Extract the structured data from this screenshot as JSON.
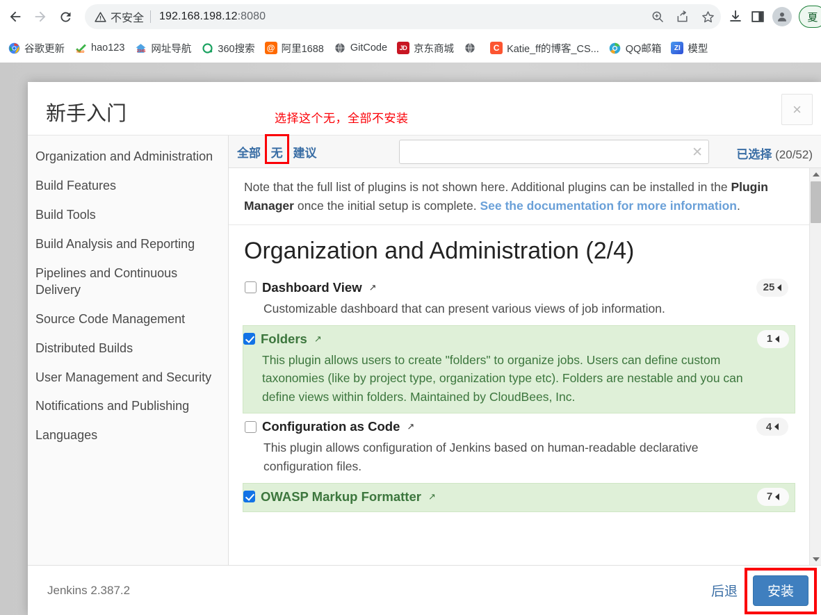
{
  "browser": {
    "nav": {
      "back_label": "Back",
      "forward_label": "Forward",
      "reload_label": "Reload"
    },
    "omnibox": {
      "warning_icon": "warning-triangle-icon",
      "warning_text": "不安全",
      "url_host": "192.168.198.12",
      "url_port": ":8080",
      "actions": [
        "zoom-icon",
        "share-icon",
        "bookmark-star-icon"
      ]
    },
    "toolbar_right": [
      "download-icon",
      "side-panel-icon",
      "account-avatar-icon"
    ],
    "profile_pill_text": "夏",
    "bookmarks": [
      {
        "label": "谷歌更新",
        "icon": "chrome-icon",
        "icon_text": "",
        "color": "#4285f4"
      },
      {
        "label": "hao123",
        "icon": "hao123-icon",
        "icon_text": "hao",
        "color": "#ffffff"
      },
      {
        "label": "网址导航",
        "icon": "2345-navigation-icon",
        "icon_text": "2345",
        "color": "#ffffff"
      },
      {
        "label": "360搜索",
        "icon": "360-search-icon",
        "icon_text": "O",
        "color": "#ffffff"
      },
      {
        "label": "阿里1688",
        "icon": "alibaba-1688-icon",
        "icon_text": "@",
        "color": "#ff6a00"
      },
      {
        "label": "GitCode",
        "icon": "globe-icon",
        "icon_text": "",
        "color": "#5f6368"
      },
      {
        "label": "京东商城",
        "icon": "jd-icon",
        "icon_text": "JD",
        "color": "#c81623"
      },
      {
        "label": "",
        "icon": "globe-icon",
        "icon_text": "",
        "color": "#5f6368"
      },
      {
        "label": "Katie_ff的博客_CS...",
        "icon": "csdn-icon",
        "icon_text": "C",
        "color": "#fc5531"
      },
      {
        "label": "QQ邮箱",
        "icon": "qq-mail-icon",
        "icon_text": "",
        "color": "#ffffff"
      },
      {
        "label": "模型",
        "icon": "zl-icon",
        "icon_text": "ZI",
        "color": "#2d6ad6"
      }
    ]
  },
  "modal": {
    "title": "新手入门",
    "close_label": "×",
    "annotation_top": "选择这个无，全部不安装",
    "sidebar": {
      "items": [
        "Organization and Administration",
        "Build Features",
        "Build Tools",
        "Build Analysis and Reporting",
        "Pipelines and Continuous Delivery",
        "Source Code Management",
        "Distributed Builds",
        "User Management and Security",
        "Notifications and Publishing",
        "Languages"
      ],
      "active_index": 0
    },
    "filter_bar": {
      "all_label": "全部",
      "none_label": "无",
      "suggested_label": "建议",
      "separator": "|",
      "search_value": "",
      "search_placeholder": "",
      "search_clear_icon": "clear-x-icon",
      "selected_label": "已选择",
      "selected_count": "(20/52)"
    },
    "note": {
      "part1": "Note that the full list of plugins is not shown here. Additional plugins can be installed in the ",
      "bold1": "Plugin Manager",
      "part2": " once the initial setup is complete. ",
      "link": "See the documentation for more information",
      "part3": "."
    },
    "section_heading": "Organization and Administration (2/4)",
    "plugins": [
      {
        "name": "Dashboard View",
        "external_icon": "external-link-icon",
        "description": "Customizable dashboard that can present various views of job information.",
        "badge": "25",
        "selected": false
      },
      {
        "name": "Folders",
        "external_icon": "external-link-icon",
        "description": "This plugin allows users to create \"folders\" to organize jobs. Users can define custom taxonomies (like by project type, organization type etc). Folders are nestable and you can define views within folders. Maintained by CloudBees, Inc.",
        "badge": "1",
        "selected": true
      },
      {
        "name": "Configuration as Code",
        "external_icon": "external-link-icon",
        "description": "This plugin allows configuration of Jenkins based on human-readable declarative configuration files.",
        "badge": "4",
        "selected": false
      },
      {
        "name": "OWASP Markup Formatter",
        "external_icon": "external-link-icon",
        "description": "",
        "badge": "7",
        "selected": true
      }
    ],
    "footer": {
      "version": "Jenkins 2.387.2",
      "back_label": "后退",
      "install_label": "安装"
    }
  },
  "colors": {
    "annotation_red": "#fb0007",
    "link_blue": "#3a6ea5",
    "selected_green_bg": "#dff0d8",
    "selected_green_text": "#3c763d",
    "checkbox_blue": "#1273e6",
    "install_button": "#3f7fbf"
  }
}
